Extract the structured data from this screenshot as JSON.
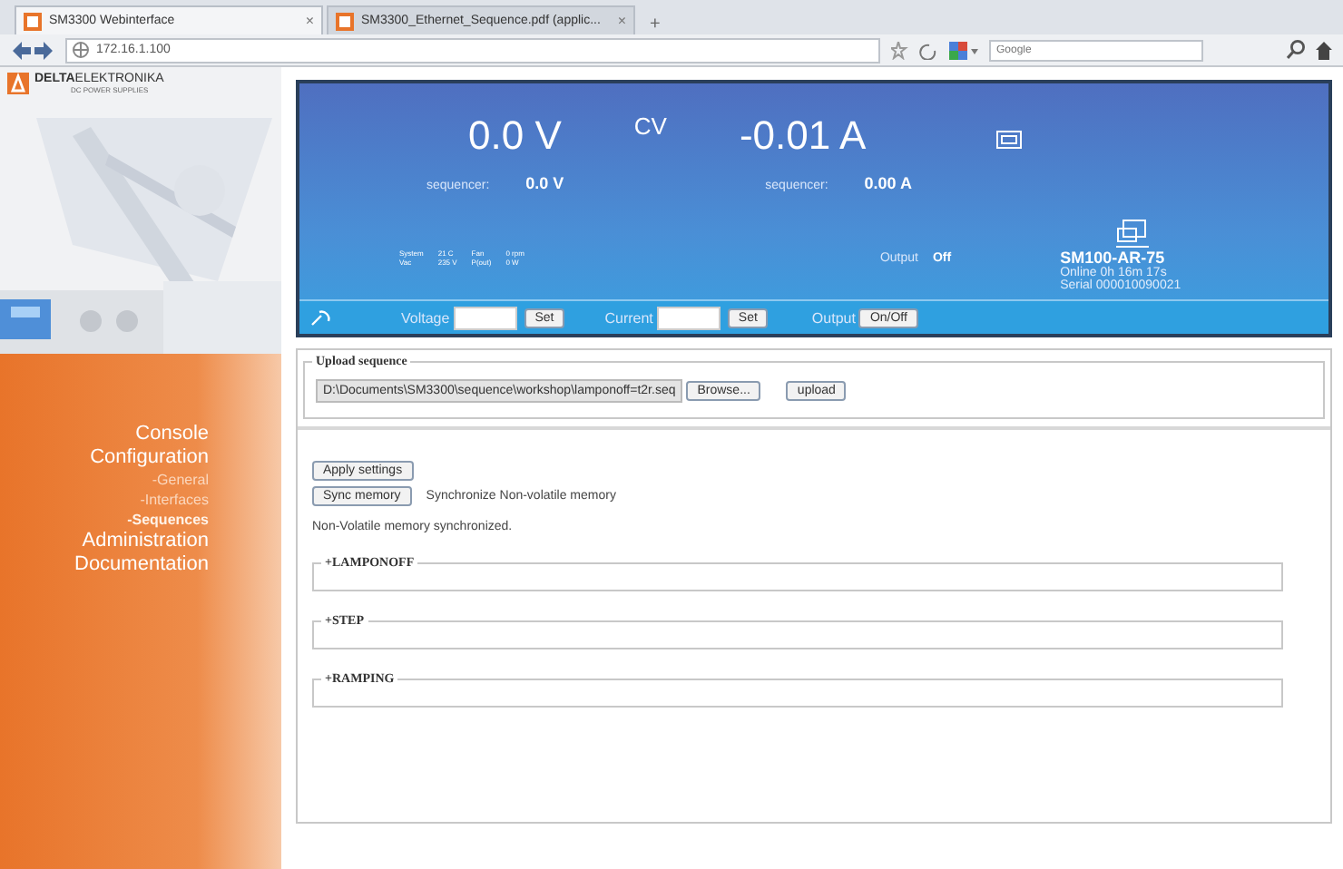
{
  "browser": {
    "tabs": [
      {
        "title": "SM3300 Webinterface",
        "selected": true,
        "close": "×"
      },
      {
        "title": "SM3300_Ethernet_Sequence.pdf (applic...",
        "selected": false,
        "close": "×"
      }
    ],
    "new_tab": "+",
    "address": "172.16.1.100",
    "search": {
      "placeholder": "Google"
    }
  },
  "sidebar": {
    "logo": {
      "brand_bold": "DELTA",
      "brand": "ELEKTRONIKA",
      "tagline": "DC POWER SUPPLIES"
    },
    "menu": [
      {
        "label": "Console",
        "selected": false
      },
      {
        "label": "Configuration",
        "selected": false,
        "children": [
          {
            "label": "-General",
            "selected": false
          },
          {
            "label": "-Interfaces",
            "selected": false
          },
          {
            "label": "-Sequences",
            "selected": true
          }
        ]
      },
      {
        "label": "Administration",
        "selected": false
      },
      {
        "label": "Documentation",
        "selected": false
      }
    ]
  },
  "display": {
    "voltage": "0.0 V",
    "mode": "CV",
    "current": "-0.01 A",
    "voltage_seq_label": "sequencer:",
    "voltage_seq": "0.0 V",
    "current_seq_label": "sequencer:",
    "current_seq": "0.00 A",
    "stats": [
      [
        "System",
        "21 C",
        "Fan",
        "0 rpm"
      ],
      [
        "Vac",
        "235 V",
        "P(out)",
        "0 W"
      ]
    ],
    "output_label": "Output",
    "output_state": "Off",
    "device": {
      "model": "SM100-AR-75",
      "online": "Online  0h 16m 17s",
      "serial": "Serial  000010090021"
    },
    "controls": {
      "voltage_label": "Voltage",
      "set1": "Set",
      "current_label": "Current",
      "set2": "Set",
      "output_label": "Output",
      "toggle": "On/Off"
    }
  },
  "upload": {
    "legend": "Upload sequence",
    "file": "D:\\Documents\\SM3300\\sequence\\workshop\\lamponoff=t2r.seq",
    "browse": "Browse...",
    "upload": "upload"
  },
  "actions": {
    "apply": "Apply settings",
    "sync": "Sync memory",
    "sync_note": "Synchronize Non-volatile memory",
    "message": "Non-Volatile memory synchronized."
  },
  "sequences": [
    {
      "legend": "+LAMPONOFF"
    },
    {
      "legend": "+STEP"
    },
    {
      "legend": "+RAMPING"
    }
  ]
}
